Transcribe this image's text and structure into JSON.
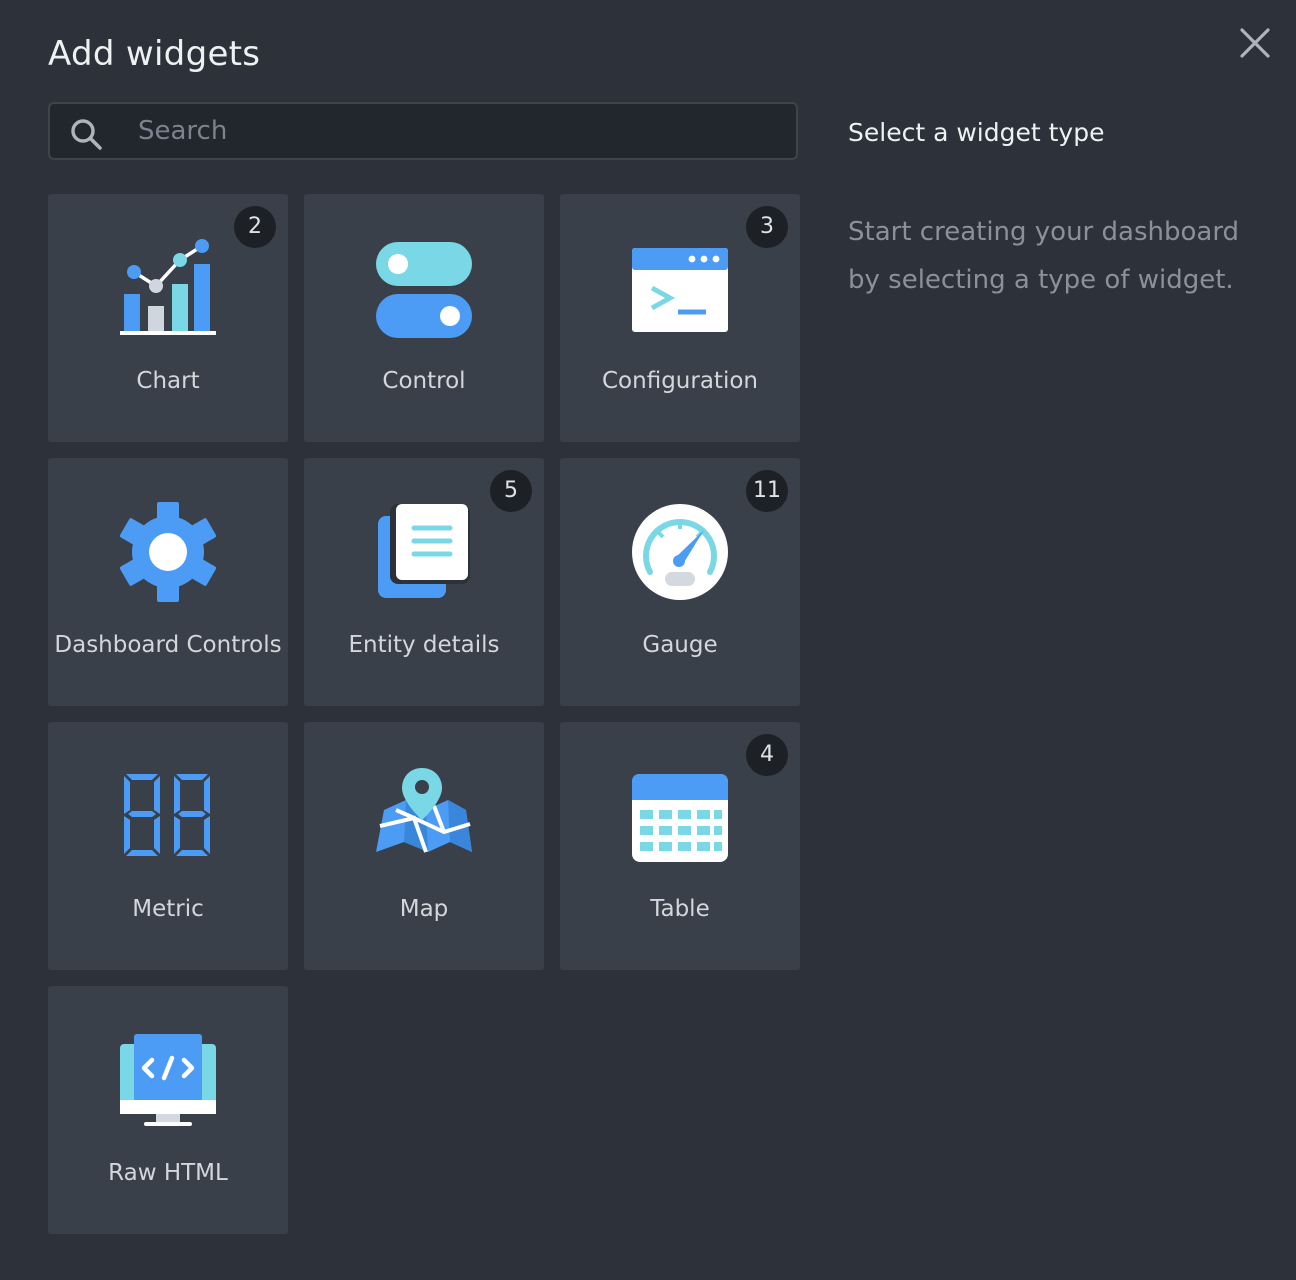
{
  "dialog": {
    "title": "Add widgets",
    "close_icon": "close-icon"
  },
  "search": {
    "placeholder": "Search",
    "value": "",
    "icon": "search-icon"
  },
  "side_panel": {
    "heading": "Select a widget type",
    "description": "Start creating your dashboard by selecting a type of widget."
  },
  "widgets": [
    {
      "label": "Chart",
      "badge": "2",
      "icon": "chart-icon"
    },
    {
      "label": "Control",
      "badge": "",
      "icon": "toggle-icon"
    },
    {
      "label": "Configuration",
      "badge": "3",
      "icon": "terminal-icon"
    },
    {
      "label": "Dashboard Controls",
      "badge": "",
      "icon": "gear-icon"
    },
    {
      "label": "Entity details",
      "badge": "5",
      "icon": "document-icon"
    },
    {
      "label": "Gauge",
      "badge": "11",
      "icon": "gauge-icon"
    },
    {
      "label": "Metric",
      "badge": "",
      "icon": "digits-icon"
    },
    {
      "label": "Map",
      "badge": "",
      "icon": "map-pin-icon"
    },
    {
      "label": "Table",
      "badge": "4",
      "icon": "table-icon"
    },
    {
      "label": "Raw HTML",
      "badge": "",
      "icon": "code-monitor-icon"
    }
  ],
  "colors": {
    "background": "#2d323a",
    "tile": "#394049",
    "badge": "#1d2126",
    "accent_blue": "#4c9cf5",
    "accent_cyan": "#7ad8e6"
  }
}
